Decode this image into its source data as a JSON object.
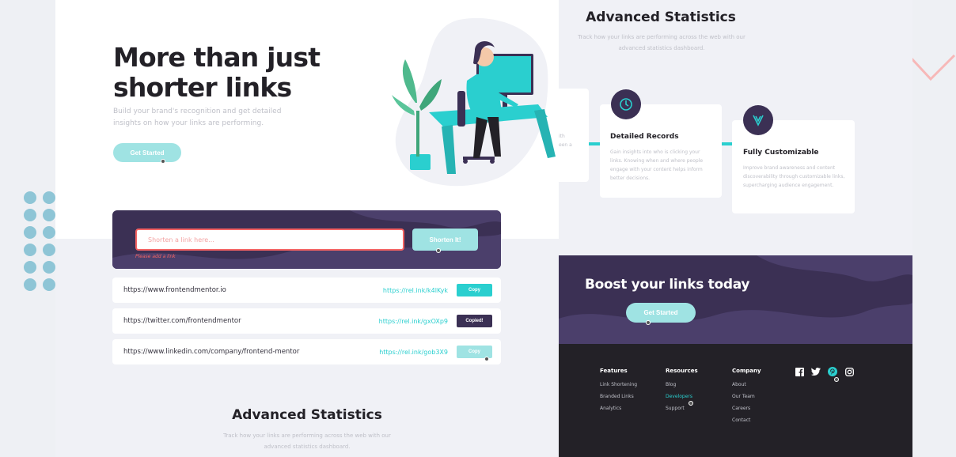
{
  "hero": {
    "title": "More than just shorter links",
    "description": "Build your brand's recognition and get detailed insights on how your links are performing.",
    "cta_label": "Get Started"
  },
  "shorten": {
    "placeholder": "Shorten a link here...",
    "error": "Please add a link",
    "button_label": "Shorten It!"
  },
  "results": [
    {
      "original": "https://www.frontendmentor.io",
      "short": "https://rel.ink/k4lKyk",
      "copy_label": "Copy",
      "state": "default"
    },
    {
      "original": "https://twitter.com/frontendmentor",
      "short": "https://rel.ink/gxOXp9",
      "copy_label": "Copied!",
      "state": "copied"
    },
    {
      "original": "https://www.linkedin.com/company/frontend-mentor",
      "short": "https://rel.ink/gob3X9",
      "copy_label": "Copy",
      "state": "hover"
    }
  ],
  "stats": {
    "title": "Advanced Statistics",
    "description": "Track how your links are performing across the web with our advanced statistics dashboard.",
    "cards": [
      {
        "title": "Detailed Records",
        "text": "Gain insights into who is clicking your links. Knowing when and where people engage with your content helps inform better decisions.",
        "icon": "records-icon"
      },
      {
        "title": "Fully Customizable",
        "text": "Improve brand awareness and content discoverability through customizable links, supercharging audience engagement.",
        "icon": "pen-tool-icon"
      }
    ],
    "partial_card_text": [
      "ith",
      "een a"
    ]
  },
  "boost": {
    "title": "Boost your links today",
    "cta_label": "Get Started"
  },
  "footer": {
    "columns": [
      {
        "heading": "Features",
        "links": [
          "Link Shortening",
          "Branded Links",
          "Analytics"
        ]
      },
      {
        "heading": "Resources",
        "links": [
          "Blog",
          "Developers",
          "Support"
        ]
      },
      {
        "heading": "Company",
        "links": [
          "About",
          "Our Team",
          "Careers",
          "Contact"
        ]
      }
    ],
    "socials": [
      "facebook-icon",
      "twitter-icon",
      "pinterest-icon",
      "instagram-icon"
    ]
  },
  "colors": {
    "cyan": "#2acfcf",
    "cyan_light": "#9fe3e3",
    "dark_violet": "#3b3054",
    "very_dark": "#232127",
    "red": "#f46363",
    "gray": "#bfc0c8"
  }
}
